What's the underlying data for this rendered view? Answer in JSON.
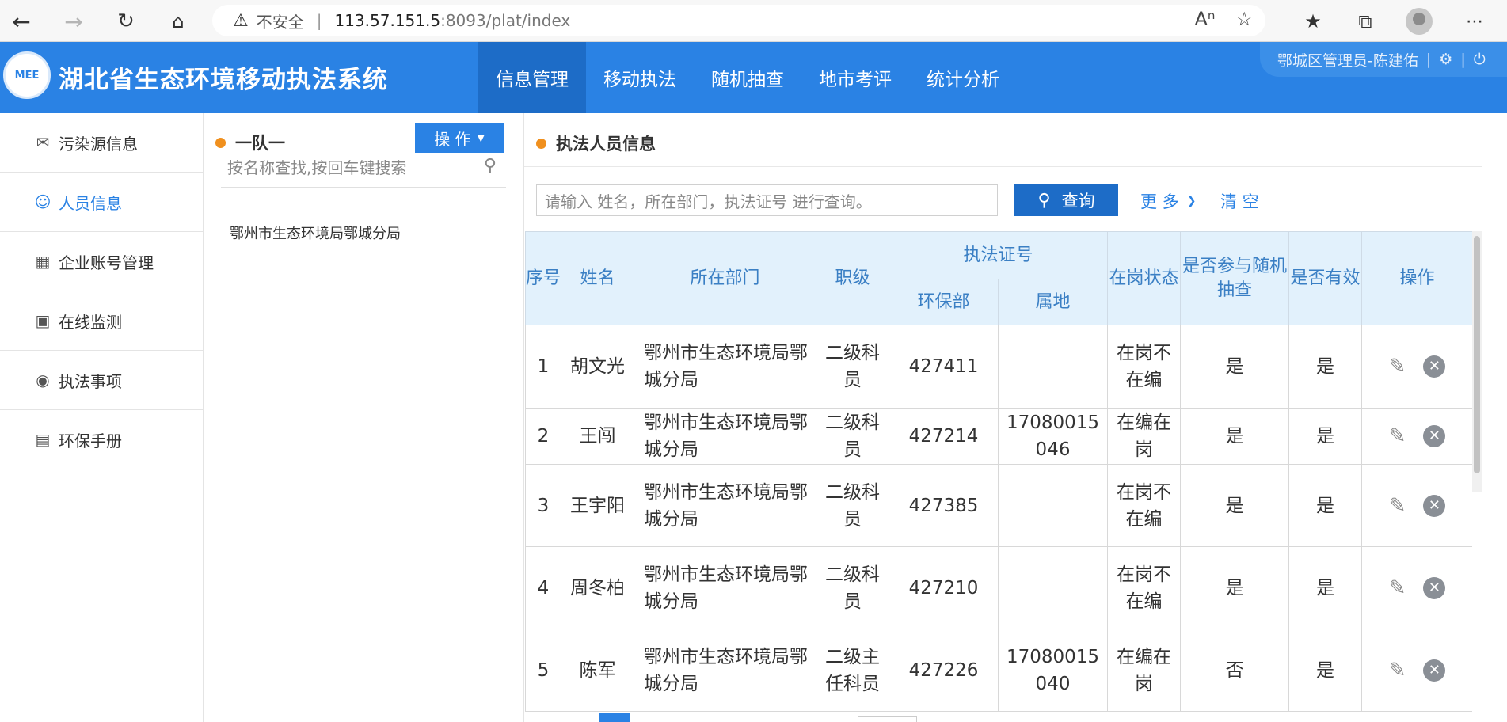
{
  "browser": {
    "insecure_label": "不安全",
    "url_host": "113.57.151.5",
    "url_path": ":8093/plat/index"
  },
  "header": {
    "logo_text": "MEE",
    "title": "湖北省生态环境移动执法系统",
    "nav": [
      "信息管理",
      "移动执法",
      "随机抽查",
      "地市考评",
      "统计分析"
    ],
    "user": "鄂城区管理员-陈建佑"
  },
  "sidebar": {
    "items": [
      {
        "label": "污染源信息",
        "icon": "pollution-source-icon"
      },
      {
        "label": "人员信息",
        "icon": "person-icon"
      },
      {
        "label": "企业账号管理",
        "icon": "building-icon"
      },
      {
        "label": "在线监测",
        "icon": "monitor-icon"
      },
      {
        "label": "执法事项",
        "icon": "officer-icon"
      },
      {
        "label": "环保手册",
        "icon": "handbook-icon"
      }
    ],
    "active_index": 1
  },
  "middle": {
    "title": "一队一",
    "operate_label": "操 作",
    "search_placeholder": "按名称查找,按回车键搜索",
    "tree_item": "鄂州市生态环境局鄂城分局"
  },
  "right": {
    "title": "执法人员信息",
    "query_placeholder": "请输入 姓名，所在部门，执法证号 进行查询。",
    "query_button": "查询",
    "more_label": "更 多",
    "clear_label": "清 空"
  },
  "table": {
    "headers": {
      "seq": "序号",
      "name": "姓名",
      "dept": "所在部门",
      "rank": "职级",
      "cert": "执法证号",
      "cert_env": "环保部",
      "cert_local": "属地",
      "status": "在岗状态",
      "random": "是否参与随机抽查",
      "valid": "是否有效",
      "ops": "操作"
    },
    "rows": [
      {
        "seq": "1",
        "name": "胡文光",
        "dept": "鄂州市生态环境局鄂城分局",
        "rank": "二级科员",
        "env": "427411",
        "local": "",
        "status": "在岗不在编",
        "random": "是",
        "valid": "是"
      },
      {
        "seq": "2",
        "name": "王闯",
        "dept": "鄂州市生态环境局鄂城分局",
        "rank": "二级科员",
        "env": "427214",
        "local": "17080015046",
        "status": "在编在岗",
        "random": "是",
        "valid": "是"
      },
      {
        "seq": "3",
        "name": "王宇阳",
        "dept": "鄂州市生态环境局鄂城分局",
        "rank": "二级科员",
        "env": "427385",
        "local": "",
        "status": "在岗不在编",
        "random": "是",
        "valid": "是"
      },
      {
        "seq": "4",
        "name": "周冬柏",
        "dept": "鄂州市生态环境局鄂城分局",
        "rank": "二级科员",
        "env": "427210",
        "local": "",
        "status": "在岗不在编",
        "random": "是",
        "valid": "是"
      },
      {
        "seq": "5",
        "name": "陈军",
        "dept": "鄂州市生态环境局鄂城分局",
        "rank": "二级主任科员",
        "env": "427226",
        "local": "17080015040",
        "status": "在编在岗",
        "random": "否",
        "valid": "是"
      }
    ]
  }
}
